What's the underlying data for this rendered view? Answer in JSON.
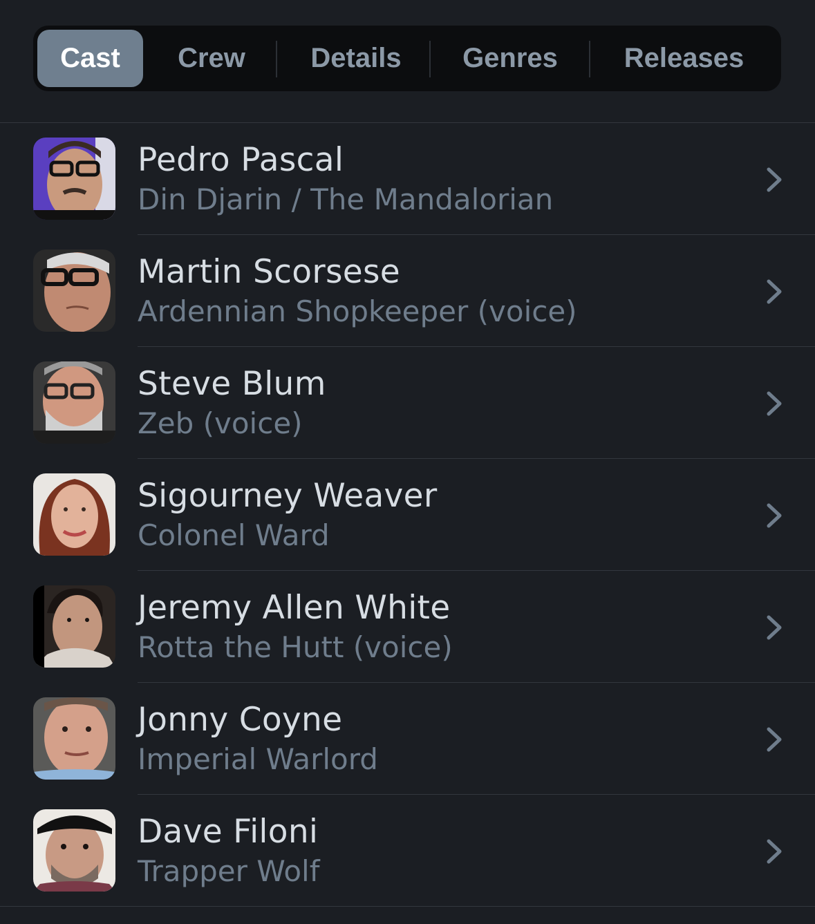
{
  "tabs": [
    {
      "label": "Cast",
      "active": true
    },
    {
      "label": "Crew",
      "active": false
    },
    {
      "label": "Details",
      "active": false
    },
    {
      "label": "Genres",
      "active": false
    },
    {
      "label": "Releases",
      "active": false
    }
  ],
  "cast": [
    {
      "name": "Pedro Pascal",
      "role": "Din Djarin / The Mandalorian"
    },
    {
      "name": "Martin Scorsese",
      "role": "Ardennian Shopkeeper (voice)"
    },
    {
      "name": "Steve Blum",
      "role": "Zeb (voice)"
    },
    {
      "name": "Sigourney Weaver",
      "role": "Colonel Ward"
    },
    {
      "name": "Jeremy Allen White",
      "role": "Rotta the Hutt (voice)"
    },
    {
      "name": "Jonny Coyne",
      "role": "Imperial Warlord"
    },
    {
      "name": "Dave Filoni",
      "role": "Trapper Wolf"
    }
  ],
  "colors": {
    "background": "#1b1e23",
    "segmented_bg": "#0c0d0f",
    "active_tab_bg": "#6f7f8f",
    "name_text": "#d7dde3",
    "role_text": "#6f7d8c",
    "chevron": "#6f7d8c"
  },
  "icons": {
    "row_accessory": "chevron-right-icon"
  }
}
